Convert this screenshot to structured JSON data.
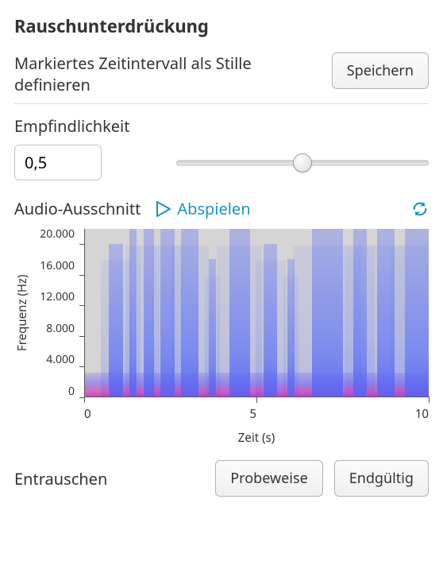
{
  "title": "Rauschunterdrückung",
  "silence": {
    "label": "Markiertes Zeitintervall als Stille definieren",
    "save_btn": "Speichern"
  },
  "sensitivity": {
    "label": "Empfindlichkeit",
    "value": "0,5",
    "slider_percent": 50
  },
  "audio": {
    "label": "Audio-Ausschnitt",
    "play_label": "Abspielen"
  },
  "denoise": {
    "label": "Entrauschen",
    "preview_btn": "Probeweise",
    "final_btn": "Endgültig"
  },
  "chart_data": {
    "type": "heatmap",
    "title": "",
    "xlabel": "Zeit (s)",
    "ylabel": "Frequenz (Hz)",
    "xlim": [
      0,
      10
    ],
    "ylim": [
      0,
      22000
    ],
    "x_ticks": [
      0,
      5,
      10
    ],
    "y_ticks": [
      0,
      4000,
      8000,
      12000,
      16000,
      20000
    ],
    "y_tick_labels": [
      "0",
      "4.000",
      "8.000",
      "12.000",
      "16.000",
      "20.000"
    ],
    "description": "Audio spectrogram showing broadband energy bursts with strong low-frequency content below ~4 kHz (magenta) and diffuse harmonics up to ~20 kHz (blue).",
    "events": [
      {
        "t_start": 0.7,
        "t_end": 1.1,
        "fmax": 20000
      },
      {
        "t_start": 1.3,
        "t_end": 1.5,
        "fmax": 22000
      },
      {
        "t_start": 1.7,
        "t_end": 2.0,
        "fmax": 22000
      },
      {
        "t_start": 2.2,
        "t_end": 2.6,
        "fmax": 22000
      },
      {
        "t_start": 2.8,
        "t_end": 3.3,
        "fmax": 22000
      },
      {
        "t_start": 3.6,
        "t_end": 3.8,
        "fmax": 18000
      },
      {
        "t_start": 4.2,
        "t_end": 4.8,
        "fmax": 22000
      },
      {
        "t_start": 5.2,
        "t_end": 5.6,
        "fmax": 20000
      },
      {
        "t_start": 5.9,
        "t_end": 6.1,
        "fmax": 18000
      },
      {
        "t_start": 6.6,
        "t_end": 7.5,
        "fmax": 22000
      },
      {
        "t_start": 7.8,
        "t_end": 8.2,
        "fmax": 22000
      },
      {
        "t_start": 8.5,
        "t_end": 9.0,
        "fmax": 22000
      },
      {
        "t_start": 9.3,
        "t_end": 10.0,
        "fmax": 22000
      }
    ]
  },
  "colors": {
    "accent": "#1c94c4"
  }
}
